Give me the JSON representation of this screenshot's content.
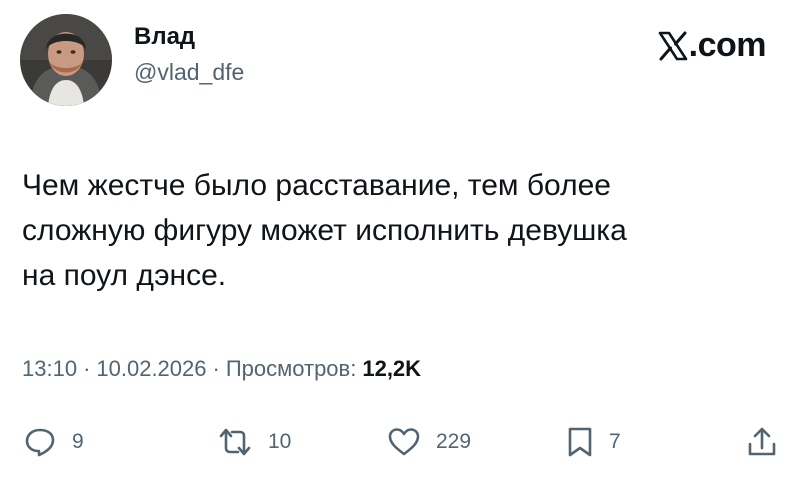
{
  "author": {
    "display_name": "Влад",
    "handle": "@vlad_dfe",
    "avatar_icon": "user-avatar"
  },
  "brand": {
    "logo_icon": "x-logo-icon",
    "label": ".com"
  },
  "tweet": {
    "text": "Чем жестче было расставание, тем более\nсложную фигуру может исполнить девушка\nна поул дэнсе."
  },
  "meta": {
    "time": "13:10",
    "separator": "·",
    "date": "10.02.2026",
    "views_label": "Просмотров:",
    "views_count": "12,2K"
  },
  "actions": {
    "replies": "9",
    "reposts": "10",
    "likes": "229",
    "bookmarks": "7"
  },
  "colors": {
    "text_primary": "#0f1419",
    "text_secondary": "#536471",
    "background": "#ffffff"
  }
}
